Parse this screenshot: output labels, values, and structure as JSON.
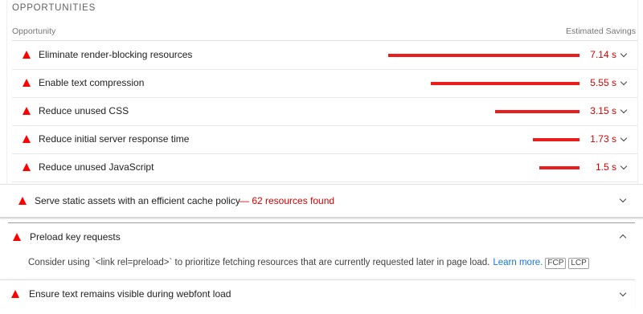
{
  "section": {
    "title": "OPPORTUNITIES",
    "col_opportunity": "Opportunity",
    "col_savings": "Estimated Savings"
  },
  "opportunities": [
    {
      "title": "Eliminate render-blocking resources",
      "savings_label": "7.14 s",
      "savings_s": 7.14
    },
    {
      "title": "Enable text compression",
      "savings_label": "5.55 s",
      "savings_s": 5.55
    },
    {
      "title": "Reduce unused CSS",
      "savings_label": "3.15 s",
      "savings_s": 3.15
    },
    {
      "title": "Reduce initial server response time",
      "savings_label": "1.73 s",
      "savings_s": 1.73
    },
    {
      "title": "Reduce unused JavaScript",
      "savings_label": "1.5 s",
      "savings_s": 1.5
    }
  ],
  "diagnostics": {
    "cache_policy": {
      "title": "Serve static assets with an efficient cache policy",
      "found": "— 62 resources found"
    },
    "preload": {
      "title": "Preload key requests",
      "description": "Consider using `<link rel=preload>` to prioritize fetching resources that are currently requested later in page load.",
      "learn_more": "Learn more.",
      "metrics": [
        "FCP",
        "LCP"
      ]
    },
    "webfont": {
      "title": "Ensure text remains visible during webfont load"
    }
  },
  "colors": {
    "fail": "#ff0000",
    "bar": "#ea1c1c",
    "link": "#1a73e8"
  },
  "icons": {
    "fail": "warning-triangle-icon",
    "expand": "chevron-down-icon",
    "collapse": "chevron-up-icon"
  }
}
